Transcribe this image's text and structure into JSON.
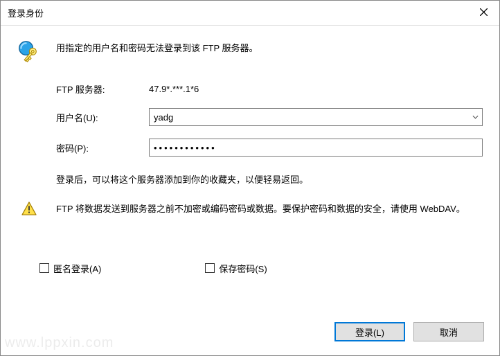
{
  "window": {
    "title": "登录身份"
  },
  "message": "用指定的用户名和密码无法登录到该 FTP 服务器。",
  "form": {
    "server_label": "FTP 服务器:",
    "server_value": "47.9*.***.1*6",
    "user_label": "用户名(U):",
    "user_value": "yadg",
    "password_label": "密码(P):",
    "password_value": "••••••••••••"
  },
  "info": "登录后，可以将这个服务器添加到你的收藏夹，以便轻易返回。",
  "warning": "FTP 将数据发送到服务器之前不加密或编码密码或数据。要保护密码和数据的安全，请使用 WebDAV。",
  "checkboxes": {
    "anonymous": "匿名登录(A)",
    "save_password": "保存密码(S)"
  },
  "buttons": {
    "login": "登录(L)",
    "cancel": "取消"
  },
  "watermark": "www.lppxin.com"
}
